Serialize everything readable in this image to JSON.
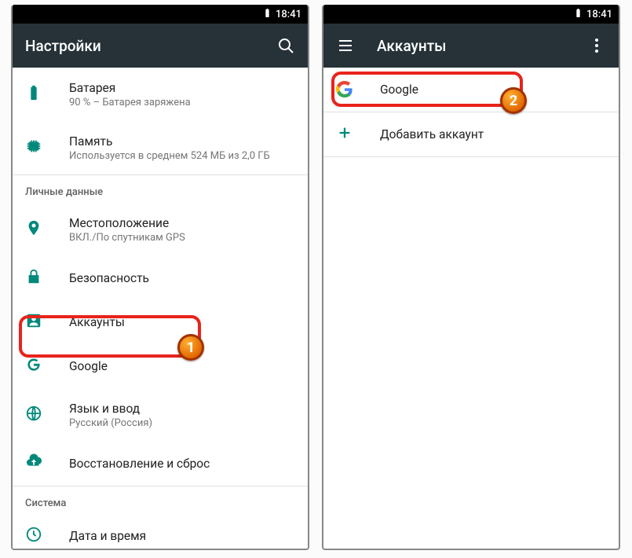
{
  "status": {
    "time": "18:41"
  },
  "colors": {
    "accent": "#00897b",
    "appbar": "#263238",
    "highlight": "#e8231b"
  },
  "left": {
    "title": "Настройки",
    "items": {
      "battery": {
        "label": "Батарея",
        "sub": "90 % – Батарея заряжена"
      },
      "memory": {
        "label": "Память",
        "sub": "Используется в среднем 524 МБ из 2,0 ГБ"
      },
      "section_personal": "Личные данные",
      "location": {
        "label": "Местоположение",
        "sub": "ВКЛ./По спутникам GPS"
      },
      "security": {
        "label": "Безопасность"
      },
      "accounts": {
        "label": "Аккаунты"
      },
      "google": {
        "label": "Google"
      },
      "lang": {
        "label": "Язык и ввод",
        "sub": "Русский (Россия)"
      },
      "backup": {
        "label": "Восстановление и сброс"
      },
      "section_system": "Система",
      "datetime": {
        "label": "Дата и время"
      }
    }
  },
  "right": {
    "title": "Аккаунты",
    "google_label": "Google",
    "add_label": "Добавить аккаунт"
  },
  "callouts": {
    "one": "1",
    "two": "2"
  }
}
